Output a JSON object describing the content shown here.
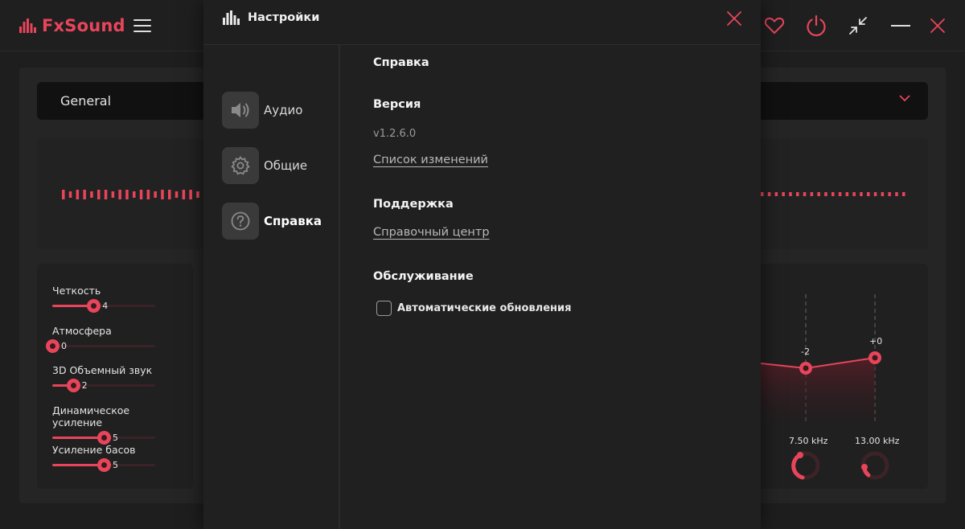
{
  "app": {
    "name": "FxSound",
    "colors": {
      "accent": "#e8455b",
      "background": "#1e1e1e",
      "panel": "#202020"
    }
  },
  "window_controls": {
    "icons": [
      "heart-icon",
      "power-icon",
      "minimize-to-compact-icon",
      "minimize-icon",
      "close-icon"
    ]
  },
  "preset": {
    "selected": "General"
  },
  "effects": [
    {
      "label": "Четкость",
      "value": "4",
      "level": 0.4
    },
    {
      "label": "Атмосфера",
      "value": "0",
      "level": 0.0
    },
    {
      "label": "3D Объемный звук",
      "value": "2",
      "level": 0.2
    },
    {
      "label": "Динамическое усиление",
      "value": "5",
      "level": 0.5
    },
    {
      "label": "Усиление басов",
      "value": "5",
      "level": 0.5
    }
  ],
  "equalizer": {
    "bands": [
      {
        "gain_label": "-2",
        "frequency": "7.50 kHz"
      },
      {
        "gain_label": "+0",
        "frequency": "13.00 kHz"
      }
    ]
  },
  "settings": {
    "title": "Настройки",
    "nav": [
      {
        "label": "Аудио",
        "icon": "speaker-icon",
        "active": false
      },
      {
        "label": "Общие",
        "icon": "gear-icon",
        "active": false
      },
      {
        "label": "Справка",
        "icon": "help-icon",
        "active": true
      }
    ],
    "help": {
      "heading": "Справка",
      "version_heading": "Версия",
      "version": "v1.2.6.0",
      "changelog_link": "Список изменений",
      "support_heading": "Поддержка",
      "help_center_link": "Справочный центр",
      "maintenance_heading": "Обслуживание",
      "auto_updates_label": "Автоматические обновления",
      "auto_updates_checked": false
    }
  }
}
